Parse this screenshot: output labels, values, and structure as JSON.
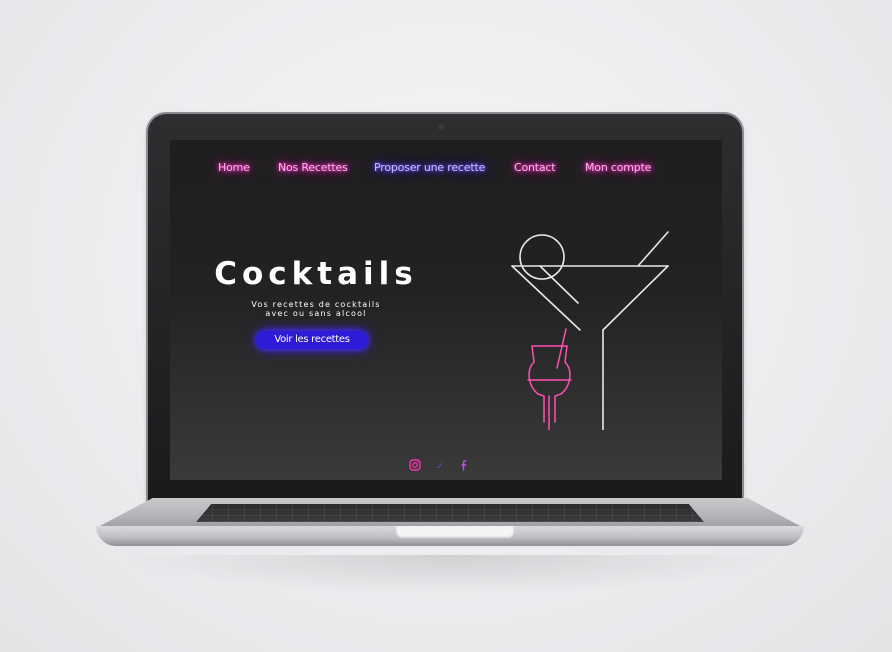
{
  "nav": {
    "items": [
      {
        "label": "Home",
        "color": "pink"
      },
      {
        "label": "Nos Recettes",
        "color": "pink"
      },
      {
        "label": "Proposer une recette",
        "color": "purple"
      },
      {
        "label": "Contact",
        "color": "pink"
      },
      {
        "label": "Mon compte",
        "color": "pink"
      }
    ]
  },
  "hero": {
    "title": "Cocktails",
    "subtitle_line1": "Vos recettes de cocktails",
    "subtitle_line2": "avec ou sans alcool",
    "cta_label": "Voir les recettes"
  },
  "socials": [
    {
      "icon": "instagram-icon",
      "color": "#ff2fb0"
    },
    {
      "icon": "twitter-icon",
      "color": "#7b5cff"
    },
    {
      "icon": "facebook-icon",
      "color": "#c24bff"
    }
  ],
  "colors": {
    "neon_pink": "#ff2ac0",
    "neon_purple": "#5b3dff",
    "cta_blue": "#2d1bd8",
    "screen_bg": "#1f1e1f"
  }
}
